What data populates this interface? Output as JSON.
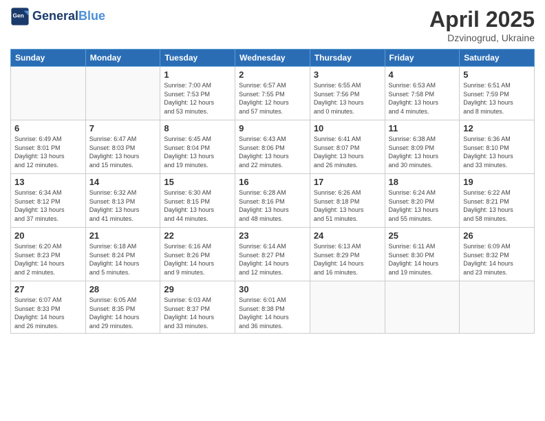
{
  "header": {
    "logo_line1": "General",
    "logo_line2": "Blue",
    "month": "April 2025",
    "location": "Dzvinogrud, Ukraine"
  },
  "weekdays": [
    "Sunday",
    "Monday",
    "Tuesday",
    "Wednesday",
    "Thursday",
    "Friday",
    "Saturday"
  ],
  "weeks": [
    [
      {
        "day": "",
        "info": ""
      },
      {
        "day": "",
        "info": ""
      },
      {
        "day": "1",
        "info": "Sunrise: 7:00 AM\nSunset: 7:53 PM\nDaylight: 12 hours\nand 53 minutes."
      },
      {
        "day": "2",
        "info": "Sunrise: 6:57 AM\nSunset: 7:55 PM\nDaylight: 12 hours\nand 57 minutes."
      },
      {
        "day": "3",
        "info": "Sunrise: 6:55 AM\nSunset: 7:56 PM\nDaylight: 13 hours\nand 0 minutes."
      },
      {
        "day": "4",
        "info": "Sunrise: 6:53 AM\nSunset: 7:58 PM\nDaylight: 13 hours\nand 4 minutes."
      },
      {
        "day": "5",
        "info": "Sunrise: 6:51 AM\nSunset: 7:59 PM\nDaylight: 13 hours\nand 8 minutes."
      }
    ],
    [
      {
        "day": "6",
        "info": "Sunrise: 6:49 AM\nSunset: 8:01 PM\nDaylight: 13 hours\nand 12 minutes."
      },
      {
        "day": "7",
        "info": "Sunrise: 6:47 AM\nSunset: 8:03 PM\nDaylight: 13 hours\nand 15 minutes."
      },
      {
        "day": "8",
        "info": "Sunrise: 6:45 AM\nSunset: 8:04 PM\nDaylight: 13 hours\nand 19 minutes."
      },
      {
        "day": "9",
        "info": "Sunrise: 6:43 AM\nSunset: 8:06 PM\nDaylight: 13 hours\nand 22 minutes."
      },
      {
        "day": "10",
        "info": "Sunrise: 6:41 AM\nSunset: 8:07 PM\nDaylight: 13 hours\nand 26 minutes."
      },
      {
        "day": "11",
        "info": "Sunrise: 6:38 AM\nSunset: 8:09 PM\nDaylight: 13 hours\nand 30 minutes."
      },
      {
        "day": "12",
        "info": "Sunrise: 6:36 AM\nSunset: 8:10 PM\nDaylight: 13 hours\nand 33 minutes."
      }
    ],
    [
      {
        "day": "13",
        "info": "Sunrise: 6:34 AM\nSunset: 8:12 PM\nDaylight: 13 hours\nand 37 minutes."
      },
      {
        "day": "14",
        "info": "Sunrise: 6:32 AM\nSunset: 8:13 PM\nDaylight: 13 hours\nand 41 minutes."
      },
      {
        "day": "15",
        "info": "Sunrise: 6:30 AM\nSunset: 8:15 PM\nDaylight: 13 hours\nand 44 minutes."
      },
      {
        "day": "16",
        "info": "Sunrise: 6:28 AM\nSunset: 8:16 PM\nDaylight: 13 hours\nand 48 minutes."
      },
      {
        "day": "17",
        "info": "Sunrise: 6:26 AM\nSunset: 8:18 PM\nDaylight: 13 hours\nand 51 minutes."
      },
      {
        "day": "18",
        "info": "Sunrise: 6:24 AM\nSunset: 8:20 PM\nDaylight: 13 hours\nand 55 minutes."
      },
      {
        "day": "19",
        "info": "Sunrise: 6:22 AM\nSunset: 8:21 PM\nDaylight: 13 hours\nand 58 minutes."
      }
    ],
    [
      {
        "day": "20",
        "info": "Sunrise: 6:20 AM\nSunset: 8:23 PM\nDaylight: 14 hours\nand 2 minutes."
      },
      {
        "day": "21",
        "info": "Sunrise: 6:18 AM\nSunset: 8:24 PM\nDaylight: 14 hours\nand 5 minutes."
      },
      {
        "day": "22",
        "info": "Sunrise: 6:16 AM\nSunset: 8:26 PM\nDaylight: 14 hours\nand 9 minutes."
      },
      {
        "day": "23",
        "info": "Sunrise: 6:14 AM\nSunset: 8:27 PM\nDaylight: 14 hours\nand 12 minutes."
      },
      {
        "day": "24",
        "info": "Sunrise: 6:13 AM\nSunset: 8:29 PM\nDaylight: 14 hours\nand 16 minutes."
      },
      {
        "day": "25",
        "info": "Sunrise: 6:11 AM\nSunset: 8:30 PM\nDaylight: 14 hours\nand 19 minutes."
      },
      {
        "day": "26",
        "info": "Sunrise: 6:09 AM\nSunset: 8:32 PM\nDaylight: 14 hours\nand 23 minutes."
      }
    ],
    [
      {
        "day": "27",
        "info": "Sunrise: 6:07 AM\nSunset: 8:33 PM\nDaylight: 14 hours\nand 26 minutes."
      },
      {
        "day": "28",
        "info": "Sunrise: 6:05 AM\nSunset: 8:35 PM\nDaylight: 14 hours\nand 29 minutes."
      },
      {
        "day": "29",
        "info": "Sunrise: 6:03 AM\nSunset: 8:37 PM\nDaylight: 14 hours\nand 33 minutes."
      },
      {
        "day": "30",
        "info": "Sunrise: 6:01 AM\nSunset: 8:38 PM\nDaylight: 14 hours\nand 36 minutes."
      },
      {
        "day": "",
        "info": ""
      },
      {
        "day": "",
        "info": ""
      },
      {
        "day": "",
        "info": ""
      }
    ]
  ]
}
